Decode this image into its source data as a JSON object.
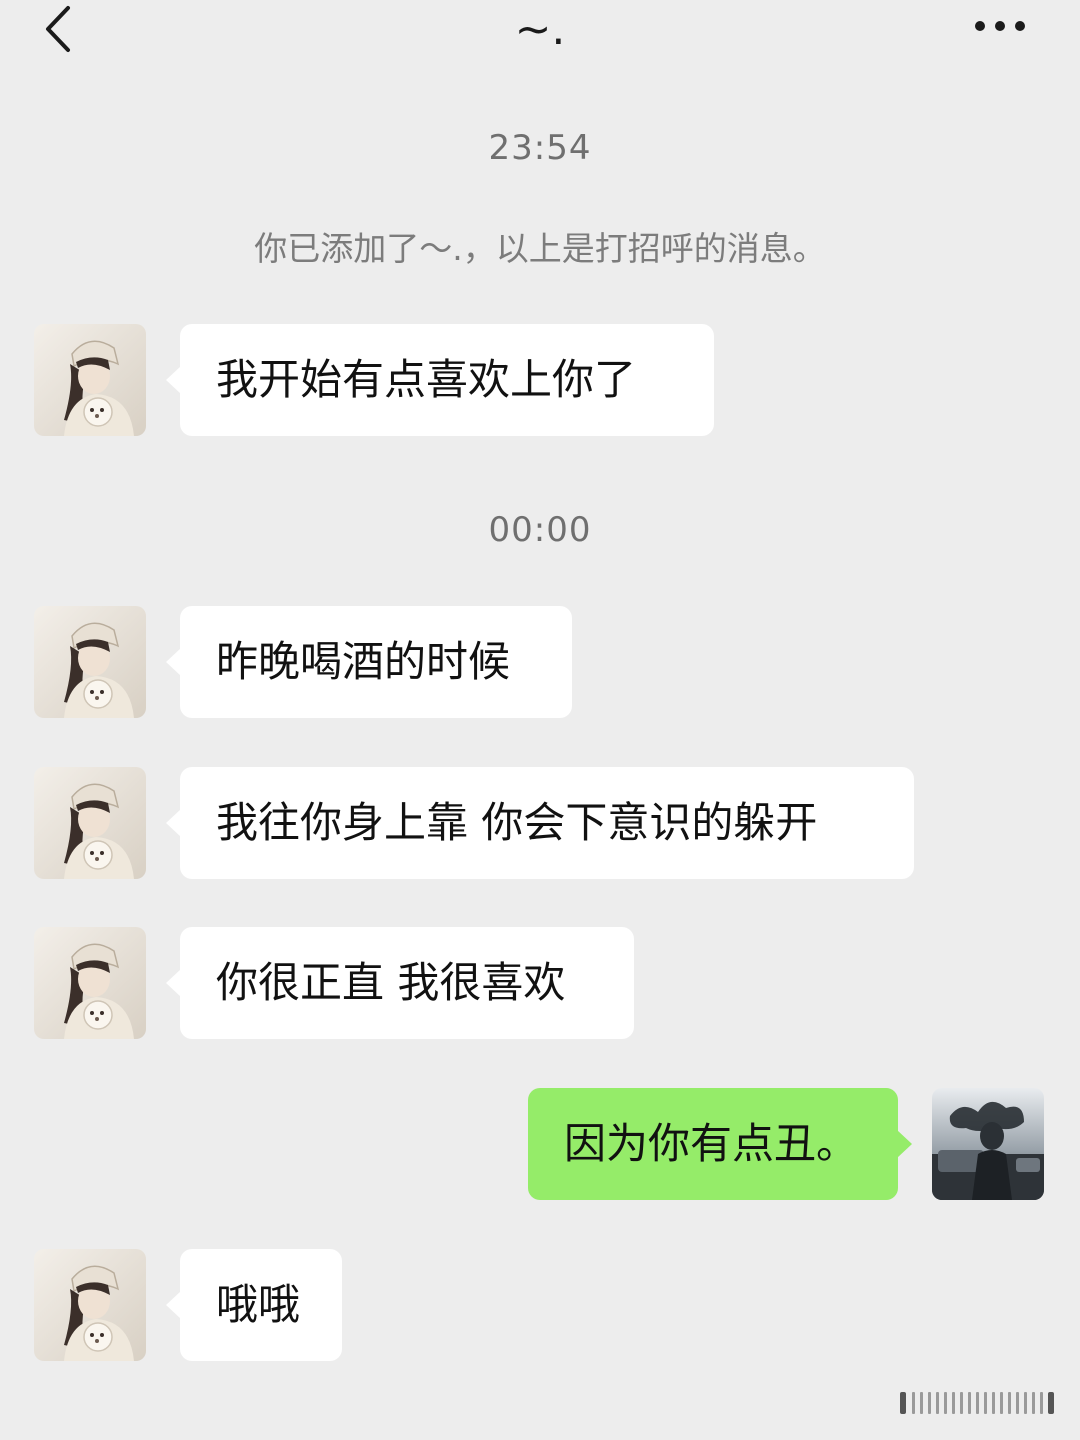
{
  "header": {
    "title": "~.",
    "back_icon": "chevron-left-icon",
    "more_icon": "more-horizontal-icon"
  },
  "conversation": {
    "time_1": "23:54",
    "system_note": "你已添加了～.，以上是打招呼的消息。",
    "time_2": "00:00"
  },
  "messages": [
    {
      "sender": "other",
      "text": "我开始有点喜欢上你了"
    },
    {
      "sender": "other",
      "text": "昨晚喝酒的时候"
    },
    {
      "sender": "other",
      "text": "我往你身上靠 你会下意识的躲开"
    },
    {
      "sender": "other",
      "text": "你很正直 我很喜欢"
    },
    {
      "sender": "self",
      "text": "因为你有点丑。"
    },
    {
      "sender": "other",
      "text": "哦哦"
    }
  ],
  "colors": {
    "background": "#ededed",
    "incoming_bubble": "#ffffff",
    "outgoing_bubble": "#95ec69",
    "time_text": "#6f6f6f"
  }
}
